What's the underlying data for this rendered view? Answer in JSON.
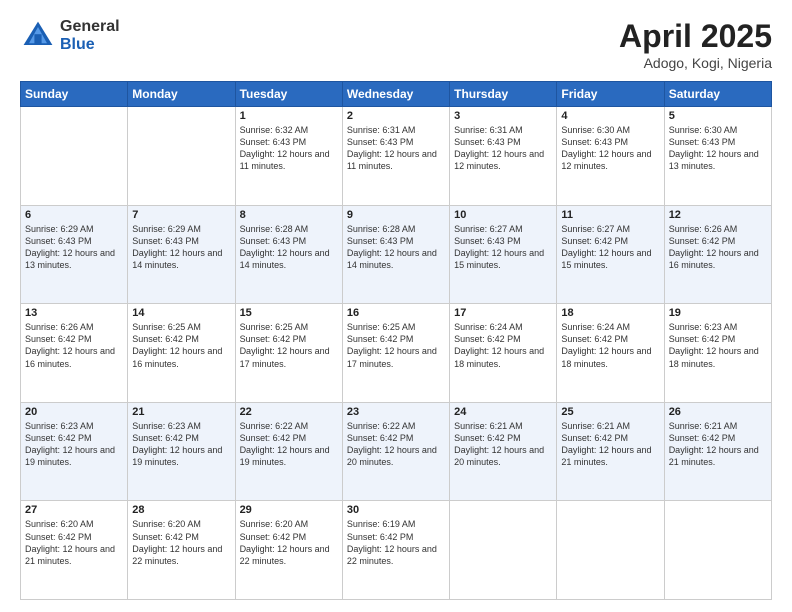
{
  "header": {
    "logo_general": "General",
    "logo_blue": "Blue",
    "title": "April 2025",
    "location": "Adogo, Kogi, Nigeria"
  },
  "days_of_week": [
    "Sunday",
    "Monday",
    "Tuesday",
    "Wednesday",
    "Thursday",
    "Friday",
    "Saturday"
  ],
  "weeks": [
    [
      {
        "day": "",
        "sunrise": "",
        "sunset": "",
        "daylight": "",
        "empty": true
      },
      {
        "day": "",
        "sunrise": "",
        "sunset": "",
        "daylight": "",
        "empty": true
      },
      {
        "day": "1",
        "sunrise": "Sunrise: 6:32 AM",
        "sunset": "Sunset: 6:43 PM",
        "daylight": "Daylight: 12 hours and 11 minutes.",
        "empty": false
      },
      {
        "day": "2",
        "sunrise": "Sunrise: 6:31 AM",
        "sunset": "Sunset: 6:43 PM",
        "daylight": "Daylight: 12 hours and 11 minutes.",
        "empty": false
      },
      {
        "day": "3",
        "sunrise": "Sunrise: 6:31 AM",
        "sunset": "Sunset: 6:43 PM",
        "daylight": "Daylight: 12 hours and 12 minutes.",
        "empty": false
      },
      {
        "day": "4",
        "sunrise": "Sunrise: 6:30 AM",
        "sunset": "Sunset: 6:43 PM",
        "daylight": "Daylight: 12 hours and 12 minutes.",
        "empty": false
      },
      {
        "day": "5",
        "sunrise": "Sunrise: 6:30 AM",
        "sunset": "Sunset: 6:43 PM",
        "daylight": "Daylight: 12 hours and 13 minutes.",
        "empty": false
      }
    ],
    [
      {
        "day": "6",
        "sunrise": "Sunrise: 6:29 AM",
        "sunset": "Sunset: 6:43 PM",
        "daylight": "Daylight: 12 hours and 13 minutes.",
        "empty": false
      },
      {
        "day": "7",
        "sunrise": "Sunrise: 6:29 AM",
        "sunset": "Sunset: 6:43 PM",
        "daylight": "Daylight: 12 hours and 14 minutes.",
        "empty": false
      },
      {
        "day": "8",
        "sunrise": "Sunrise: 6:28 AM",
        "sunset": "Sunset: 6:43 PM",
        "daylight": "Daylight: 12 hours and 14 minutes.",
        "empty": false
      },
      {
        "day": "9",
        "sunrise": "Sunrise: 6:28 AM",
        "sunset": "Sunset: 6:43 PM",
        "daylight": "Daylight: 12 hours and 14 minutes.",
        "empty": false
      },
      {
        "day": "10",
        "sunrise": "Sunrise: 6:27 AM",
        "sunset": "Sunset: 6:43 PM",
        "daylight": "Daylight: 12 hours and 15 minutes.",
        "empty": false
      },
      {
        "day": "11",
        "sunrise": "Sunrise: 6:27 AM",
        "sunset": "Sunset: 6:42 PM",
        "daylight": "Daylight: 12 hours and 15 minutes.",
        "empty": false
      },
      {
        "day": "12",
        "sunrise": "Sunrise: 6:26 AM",
        "sunset": "Sunset: 6:42 PM",
        "daylight": "Daylight: 12 hours and 16 minutes.",
        "empty": false
      }
    ],
    [
      {
        "day": "13",
        "sunrise": "Sunrise: 6:26 AM",
        "sunset": "Sunset: 6:42 PM",
        "daylight": "Daylight: 12 hours and 16 minutes.",
        "empty": false
      },
      {
        "day": "14",
        "sunrise": "Sunrise: 6:25 AM",
        "sunset": "Sunset: 6:42 PM",
        "daylight": "Daylight: 12 hours and 16 minutes.",
        "empty": false
      },
      {
        "day": "15",
        "sunrise": "Sunrise: 6:25 AM",
        "sunset": "Sunset: 6:42 PM",
        "daylight": "Daylight: 12 hours and 17 minutes.",
        "empty": false
      },
      {
        "day": "16",
        "sunrise": "Sunrise: 6:25 AM",
        "sunset": "Sunset: 6:42 PM",
        "daylight": "Daylight: 12 hours and 17 minutes.",
        "empty": false
      },
      {
        "day": "17",
        "sunrise": "Sunrise: 6:24 AM",
        "sunset": "Sunset: 6:42 PM",
        "daylight": "Daylight: 12 hours and 18 minutes.",
        "empty": false
      },
      {
        "day": "18",
        "sunrise": "Sunrise: 6:24 AM",
        "sunset": "Sunset: 6:42 PM",
        "daylight": "Daylight: 12 hours and 18 minutes.",
        "empty": false
      },
      {
        "day": "19",
        "sunrise": "Sunrise: 6:23 AM",
        "sunset": "Sunset: 6:42 PM",
        "daylight": "Daylight: 12 hours and 18 minutes.",
        "empty": false
      }
    ],
    [
      {
        "day": "20",
        "sunrise": "Sunrise: 6:23 AM",
        "sunset": "Sunset: 6:42 PM",
        "daylight": "Daylight: 12 hours and 19 minutes.",
        "empty": false
      },
      {
        "day": "21",
        "sunrise": "Sunrise: 6:23 AM",
        "sunset": "Sunset: 6:42 PM",
        "daylight": "Daylight: 12 hours and 19 minutes.",
        "empty": false
      },
      {
        "day": "22",
        "sunrise": "Sunrise: 6:22 AM",
        "sunset": "Sunset: 6:42 PM",
        "daylight": "Daylight: 12 hours and 19 minutes.",
        "empty": false
      },
      {
        "day": "23",
        "sunrise": "Sunrise: 6:22 AM",
        "sunset": "Sunset: 6:42 PM",
        "daylight": "Daylight: 12 hours and 20 minutes.",
        "empty": false
      },
      {
        "day": "24",
        "sunrise": "Sunrise: 6:21 AM",
        "sunset": "Sunset: 6:42 PM",
        "daylight": "Daylight: 12 hours and 20 minutes.",
        "empty": false
      },
      {
        "day": "25",
        "sunrise": "Sunrise: 6:21 AM",
        "sunset": "Sunset: 6:42 PM",
        "daylight": "Daylight: 12 hours and 21 minutes.",
        "empty": false
      },
      {
        "day": "26",
        "sunrise": "Sunrise: 6:21 AM",
        "sunset": "Sunset: 6:42 PM",
        "daylight": "Daylight: 12 hours and 21 minutes.",
        "empty": false
      }
    ],
    [
      {
        "day": "27",
        "sunrise": "Sunrise: 6:20 AM",
        "sunset": "Sunset: 6:42 PM",
        "daylight": "Daylight: 12 hours and 21 minutes.",
        "empty": false
      },
      {
        "day": "28",
        "sunrise": "Sunrise: 6:20 AM",
        "sunset": "Sunset: 6:42 PM",
        "daylight": "Daylight: 12 hours and 22 minutes.",
        "empty": false
      },
      {
        "day": "29",
        "sunrise": "Sunrise: 6:20 AM",
        "sunset": "Sunset: 6:42 PM",
        "daylight": "Daylight: 12 hours and 22 minutes.",
        "empty": false
      },
      {
        "day": "30",
        "sunrise": "Sunrise: 6:19 AM",
        "sunset": "Sunset: 6:42 PM",
        "daylight": "Daylight: 12 hours and 22 minutes.",
        "empty": false
      },
      {
        "day": "",
        "sunrise": "",
        "sunset": "",
        "daylight": "",
        "empty": true
      },
      {
        "day": "",
        "sunrise": "",
        "sunset": "",
        "daylight": "",
        "empty": true
      },
      {
        "day": "",
        "sunrise": "",
        "sunset": "",
        "daylight": "",
        "empty": true
      }
    ]
  ]
}
